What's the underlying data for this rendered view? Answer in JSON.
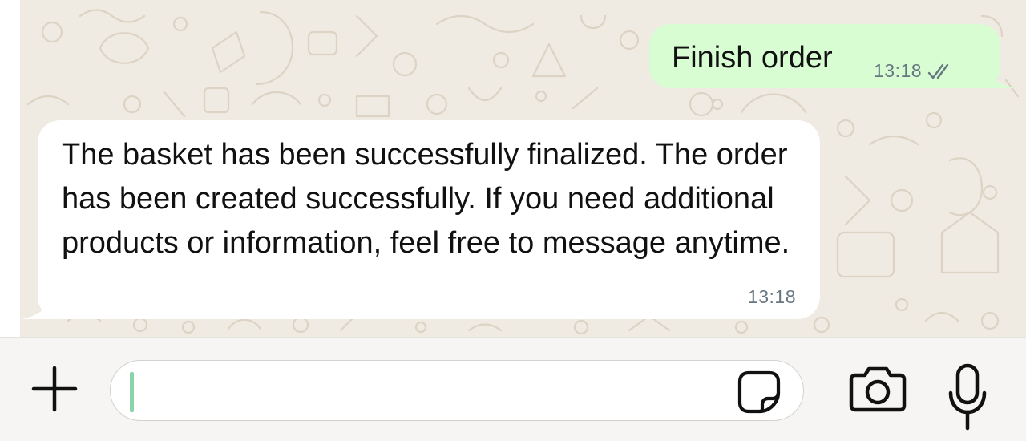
{
  "messages": [
    {
      "direction": "outgoing",
      "text": "Finish order",
      "time": "13:18",
      "status_icon": "double-check-icon"
    },
    {
      "direction": "incoming",
      "text": "The basket has been successfully finalized. The order has been created successfully. If you need additional products or information, feel free to message anytime.",
      "time": "13:18"
    }
  ],
  "composer": {
    "attach_icon": "plus-icon",
    "input_value": "",
    "sticker_icon": "sticker-icon",
    "camera_icon": "camera-icon",
    "mic_icon": "microphone-icon"
  },
  "colors": {
    "chat_background": "#efeae2",
    "outgoing_bubble": "#d9fdd3",
    "incoming_bubble": "#ffffff",
    "timestamp": "#667781",
    "composer_background": "#f6f5f3",
    "caret": "#8ad4a8"
  }
}
